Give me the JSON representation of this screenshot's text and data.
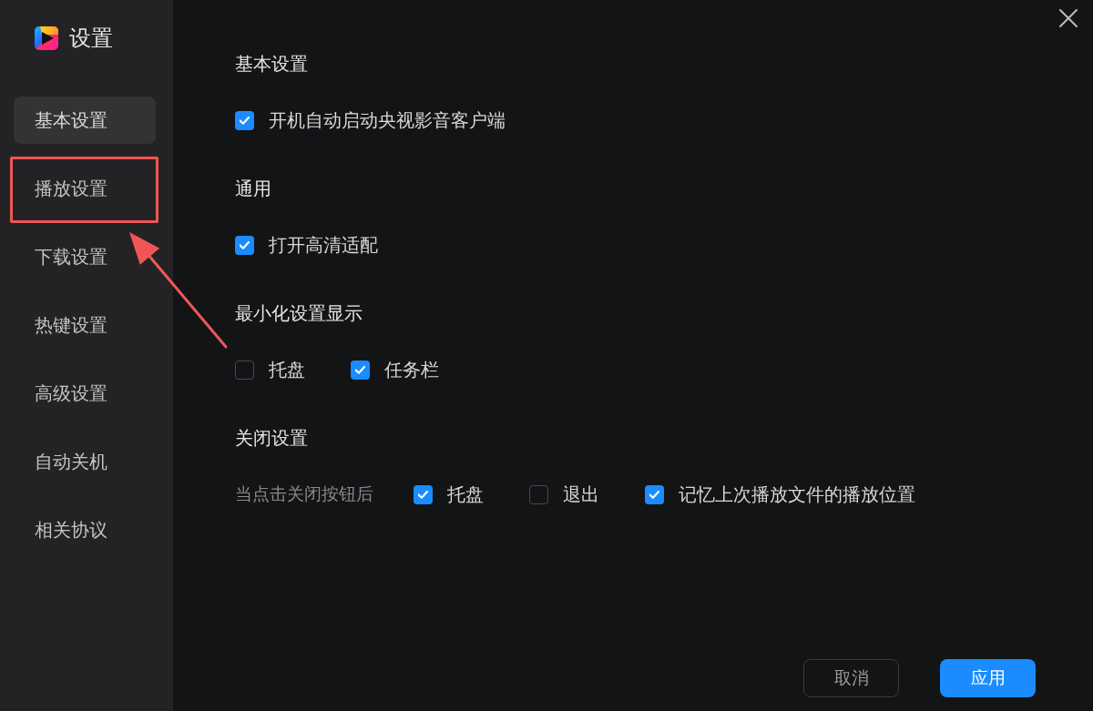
{
  "window": {
    "title": "设置"
  },
  "sidebar": {
    "items": [
      {
        "label": "基本设置",
        "selected": true,
        "highlighted": false
      },
      {
        "label": "播放设置",
        "selected": false,
        "highlighted": true
      },
      {
        "label": "下载设置",
        "selected": false,
        "highlighted": false
      },
      {
        "label": "热键设置",
        "selected": false,
        "highlighted": false
      },
      {
        "label": "高级设置",
        "selected": false,
        "highlighted": false
      },
      {
        "label": "自动关机",
        "selected": false,
        "highlighted": false
      },
      {
        "label": "相关协议",
        "selected": false,
        "highlighted": false
      }
    ]
  },
  "sections": [
    {
      "title": "基本设置",
      "options": [
        {
          "label": "开机自动启动央视影音客户端",
          "checked": true
        }
      ]
    },
    {
      "title": "通用",
      "options": [
        {
          "label": "打开高清适配",
          "checked": true
        }
      ]
    },
    {
      "title": "最小化设置显示",
      "options": [
        {
          "label": "托盘",
          "checked": false
        },
        {
          "label": "任务栏",
          "checked": true
        }
      ]
    },
    {
      "title": "关闭设置",
      "prompt": "当点击关闭按钮后",
      "options": [
        {
          "label": "托盘",
          "checked": true
        },
        {
          "label": "退出",
          "checked": false
        },
        {
          "label": "记忆上次播放文件的播放位置",
          "checked": true
        }
      ]
    }
  ],
  "buttons": [
    {
      "label": "取消",
      "kind": "secondary"
    },
    {
      "label": "应用",
      "kind": "primary"
    }
  ]
}
